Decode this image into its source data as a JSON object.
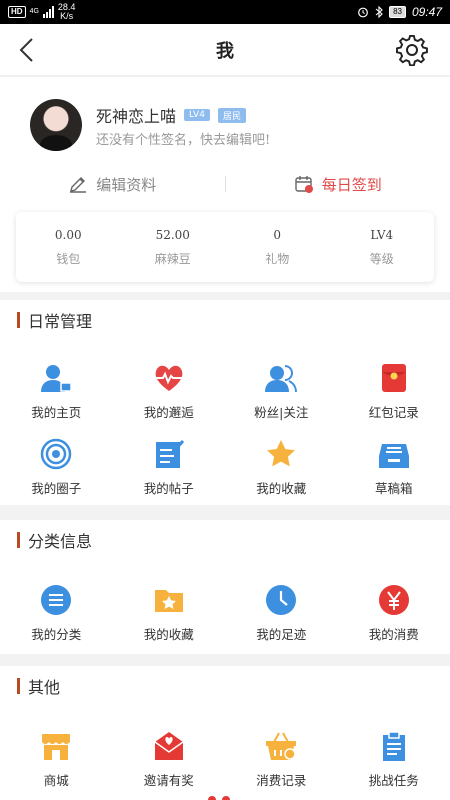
{
  "status_bar": {
    "hd": "HD",
    "network": "4G",
    "speed": "28.4",
    "speed_unit": "K/s",
    "battery": "83",
    "time": "09:47"
  },
  "header": {
    "title": "我"
  },
  "profile": {
    "name": "死神恋上喵",
    "level_badge": "LV4",
    "role_badge": "居民",
    "signature": "还没有个性签名，快去编辑吧!",
    "edit_label": "编辑资料",
    "checkin_label": "每日签到"
  },
  "stats": [
    {
      "value": "0.00",
      "label": "钱包"
    },
    {
      "value": "52.00",
      "label": "麻辣豆"
    },
    {
      "value": "0",
      "label": "礼物"
    },
    {
      "value": "LV4",
      "label": "等级"
    }
  ],
  "sections": {
    "daily": {
      "title": "日常管理",
      "items": [
        {
          "label": "我的主页",
          "icon": "home-person-icon"
        },
        {
          "label": "我的邂逅",
          "icon": "heartbeat-icon"
        },
        {
          "label": "粉丝|关注",
          "icon": "fans-icon"
        },
        {
          "label": "红包记录",
          "icon": "red-packet-icon"
        },
        {
          "label": "我的圈子",
          "icon": "circle-icon"
        },
        {
          "label": "我的帖子",
          "icon": "post-icon"
        },
        {
          "label": "我的收藏",
          "icon": "star-icon"
        },
        {
          "label": "草稿箱",
          "icon": "draft-box-icon"
        }
      ]
    },
    "category": {
      "title": "分类信息",
      "items": [
        {
          "label": "我的分类",
          "icon": "category-list-icon"
        },
        {
          "label": "我的收藏",
          "icon": "folder-star-icon"
        },
        {
          "label": "我的足迹",
          "icon": "clock-icon"
        },
        {
          "label": "我的消费",
          "icon": "yuan-icon"
        }
      ]
    },
    "other": {
      "title": "其他",
      "items": [
        {
          "label": "商城",
          "icon": "shop-icon"
        },
        {
          "label": "邀请有奖",
          "icon": "invite-mail-icon"
        },
        {
          "label": "消费记录",
          "icon": "basket-icon"
        },
        {
          "label": "挑战任务",
          "icon": "task-clipboard-icon"
        }
      ]
    }
  },
  "colors": {
    "accent_red": "#e04a4a",
    "icon_blue": "#3d8fe0",
    "icon_orange": "#f6b23c",
    "section_bar": "#b84b22"
  }
}
